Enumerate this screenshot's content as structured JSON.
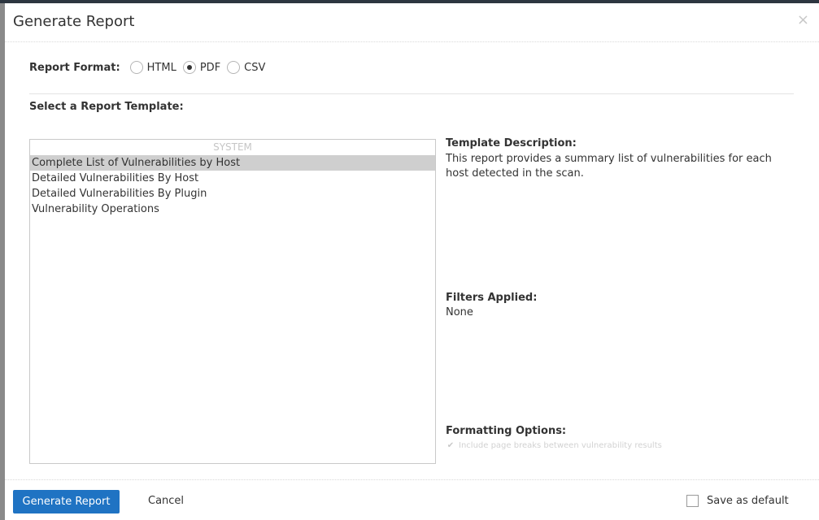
{
  "dialog": {
    "title": "Generate Report",
    "close_glyph": "×"
  },
  "format": {
    "label": "Report Format:",
    "options": [
      {
        "label": "HTML",
        "checked": false
      },
      {
        "label": "PDF",
        "checked": true
      },
      {
        "label": "CSV",
        "checked": false
      }
    ]
  },
  "templates": {
    "label": "Select a Report Template:",
    "group": "SYSTEM",
    "items": [
      "Complete List of Vulnerabilities by Host",
      "Detailed Vulnerabilities By Host",
      "Detailed Vulnerabilities By Plugin",
      "Vulnerability Operations"
    ],
    "selected_index": 0
  },
  "description": {
    "title": "Template Description:",
    "text": "This report provides a summary list of vulnerabilities for each host detected in the scan."
  },
  "filters": {
    "title": "Filters Applied:",
    "value": "None"
  },
  "formatting": {
    "title": "Formatting Options:",
    "option_label": "Include page breaks between vulnerability results",
    "option_checked": true
  },
  "footer": {
    "generate_label": "Generate Report",
    "cancel_label": "Cancel",
    "save_default_label": "Save as default",
    "save_default_checked": false
  },
  "colors": {
    "primary_button": "#1f73c3",
    "selected_row": "#cfcfcf"
  }
}
